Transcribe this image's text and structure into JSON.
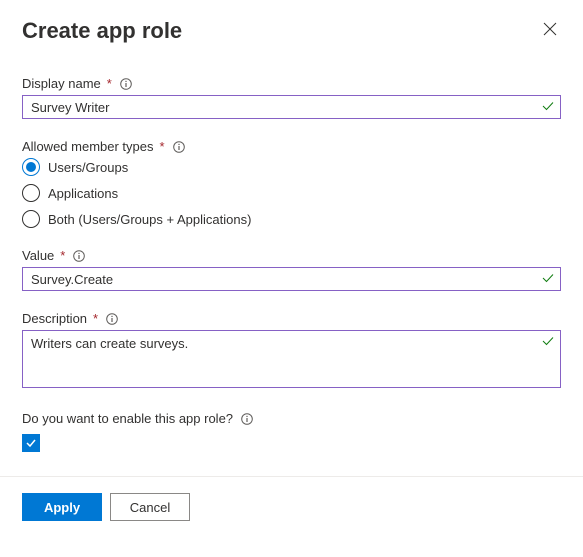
{
  "header": {
    "title": "Create app role"
  },
  "displayName": {
    "label": "Display name",
    "value": "Survey Writer"
  },
  "allowedMemberTypes": {
    "label": "Allowed member types",
    "options": [
      {
        "label": "Users/Groups",
        "selected": true
      },
      {
        "label": "Applications",
        "selected": false
      },
      {
        "label": "Both (Users/Groups + Applications)",
        "selected": false
      }
    ]
  },
  "value": {
    "label": "Value",
    "value": "Survey.Create"
  },
  "description": {
    "label": "Description",
    "value": "Writers can create surveys."
  },
  "enable": {
    "label": "Do you want to enable this app role?",
    "checked": true
  },
  "footer": {
    "apply": "Apply",
    "cancel": "Cancel"
  }
}
